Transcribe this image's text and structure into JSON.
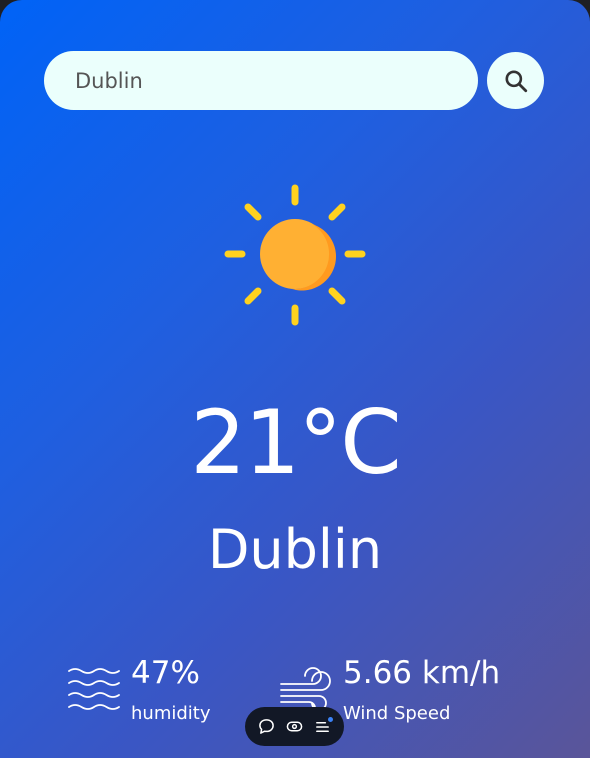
{
  "search": {
    "value": "Dublin",
    "icon": "search-icon"
  },
  "weather": {
    "icon": "sun-icon",
    "temperature": "21°C",
    "city": "Dublin"
  },
  "humidity": {
    "value": "47%",
    "label": "humidity",
    "icon": "humidity-waves-icon"
  },
  "wind": {
    "value": "5.66 km/h",
    "label": "Wind Speed",
    "icon": "wind-icon"
  },
  "toolbar": {
    "items": [
      "chat-bubble-icon",
      "toggle-icon",
      "menu-icon"
    ],
    "accent": "#3b82f6"
  },
  "colors": {
    "gradient_start": "#0063f7",
    "gradient_end": "#5a5599",
    "input_bg": "#ebfffc",
    "sun": "#ffb033",
    "sun_rays": "#ffd21f"
  }
}
